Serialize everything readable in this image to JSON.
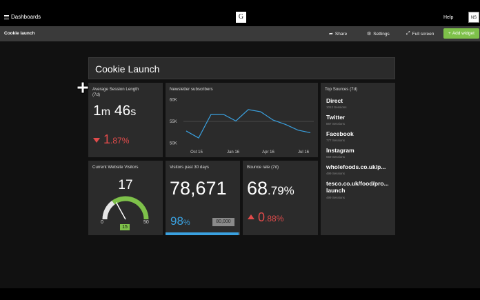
{
  "topbar": {
    "menu_label": "Dashboards",
    "logo_letter": "G",
    "help_label": "Help",
    "avatar_initials": "NS"
  },
  "subbar": {
    "title": "Cookie launch",
    "share": "Share",
    "settings": "Settings",
    "fullscreen": "Full screen",
    "add_widget": "Add widget"
  },
  "dashboard_title": "Cookie Launch",
  "avg_session": {
    "title_line1": "Average Session Length",
    "title_line2": "(7d)",
    "minutes": "1",
    "m_unit": "m",
    "seconds": "46",
    "s_unit": "s",
    "change_int": "1",
    "change_dec": ".87%"
  },
  "newsletter": {
    "title": "Newsletter subscribers",
    "chart_data": {
      "type": "line",
      "y_ticks": [
        "60K",
        "55K",
        "50K"
      ],
      "x_ticks": [
        "Oct 15",
        "Jan 16",
        "Apr 16",
        "Jul 16"
      ],
      "ylim": [
        49000,
        61000
      ],
      "grid": false,
      "series": [
        {
          "values": [
            52800,
            51200,
            56600,
            56600,
            55100,
            57700,
            57200,
            55300,
            54300,
            53000,
            52400
          ]
        }
      ],
      "color": "#3aa1e0"
    }
  },
  "top_sources": {
    "title": "Top Sources (7d)",
    "items": [
      {
        "name": "Direct",
        "sessions": "1012 Sessions"
      },
      {
        "name": "Twitter",
        "sessions": "887 Sessions"
      },
      {
        "name": "Facebook",
        "sessions": "777 Sessions"
      },
      {
        "name": "Instagram",
        "sessions": "659 Sessions"
      },
      {
        "name": "wholefoods.co.uk/p...",
        "sessions": "499 Sessions"
      },
      {
        "name_line1": "tesco.co.uk/food/pro...",
        "name_line2": "launch",
        "sessions": "499 Sessions"
      }
    ]
  },
  "current_visitors": {
    "title": "Current Website Visitors",
    "value": "17",
    "min": "0",
    "max": "50",
    "target": "15",
    "gauge_fraction": 0.34
  },
  "visitors_30d": {
    "title": "Visitors past 30 days",
    "value": "78,671",
    "percent_int": "98",
    "percent_unit": "%",
    "goal": "80,000",
    "progress_fraction": 0.98
  },
  "bounce_rate": {
    "title": "Bounce rate (7d)",
    "value_int": "68",
    "value_dec": ".79%",
    "change_int": "0",
    "change_dec": ".88%"
  },
  "colors": {
    "accent_green": "#7ec14a",
    "accent_blue": "#3aa1e0",
    "accent_red": "#e14b4b"
  }
}
